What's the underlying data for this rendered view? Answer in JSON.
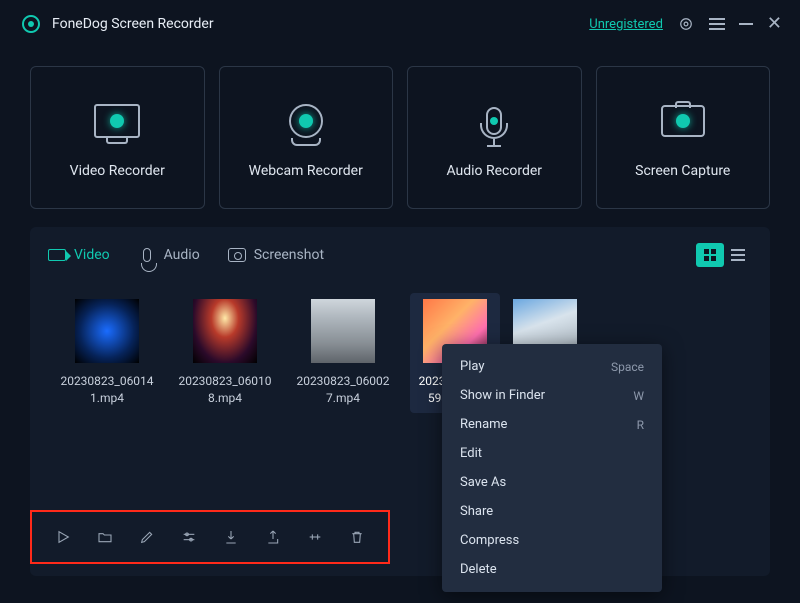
{
  "header": {
    "app_title": "FoneDog Screen Recorder",
    "status": "Unregistered"
  },
  "modes": [
    {
      "id": "video-recorder",
      "label": "Video Recorder",
      "icon": "monitor-icon"
    },
    {
      "id": "webcam-recorder",
      "label": "Webcam Recorder",
      "icon": "webcam-icon"
    },
    {
      "id": "audio-recorder",
      "label": "Audio Recorder",
      "icon": "microphone-icon"
    },
    {
      "id": "screen-capture",
      "label": "Screen Capture",
      "icon": "camera-icon"
    }
  ],
  "library": {
    "tabs": [
      {
        "id": "video",
        "label": "Video",
        "icon": "video-icon",
        "active": true
      },
      {
        "id": "audio",
        "label": "Audio",
        "icon": "audio-icon",
        "active": false
      },
      {
        "id": "screenshot",
        "label": "Screenshot",
        "icon": "screenshot-icon",
        "active": false
      }
    ],
    "view": "grid",
    "items": [
      {
        "name": "20230823_060141.mp4",
        "selected": false
      },
      {
        "name": "20230823_060108.mp4",
        "selected": false
      },
      {
        "name": "20230823_060027.mp4",
        "selected": false
      },
      {
        "name": "20230823_055932.mp4",
        "selected": true
      },
      {
        "name": "",
        "selected": false
      }
    ]
  },
  "toolbar": {
    "buttons": [
      {
        "id": "play",
        "icon": "play-icon"
      },
      {
        "id": "folder",
        "icon": "folder-icon"
      },
      {
        "id": "edit",
        "icon": "pencil-icon"
      },
      {
        "id": "adjust",
        "icon": "sliders-icon"
      },
      {
        "id": "import",
        "icon": "import-icon"
      },
      {
        "id": "export",
        "icon": "export-icon"
      },
      {
        "id": "trim",
        "icon": "trim-icon"
      },
      {
        "id": "delete",
        "icon": "trash-icon"
      }
    ]
  },
  "context_menu": {
    "items": [
      {
        "label": "Play",
        "shortcut": "Space"
      },
      {
        "label": "Show in Finder",
        "shortcut": "W"
      },
      {
        "label": "Rename",
        "shortcut": "R"
      },
      {
        "label": "Edit",
        "shortcut": ""
      },
      {
        "label": "Save As",
        "shortcut": ""
      },
      {
        "label": "Share",
        "shortcut": ""
      },
      {
        "label": "Compress",
        "shortcut": ""
      },
      {
        "label": "Delete",
        "shortcut": ""
      }
    ]
  }
}
